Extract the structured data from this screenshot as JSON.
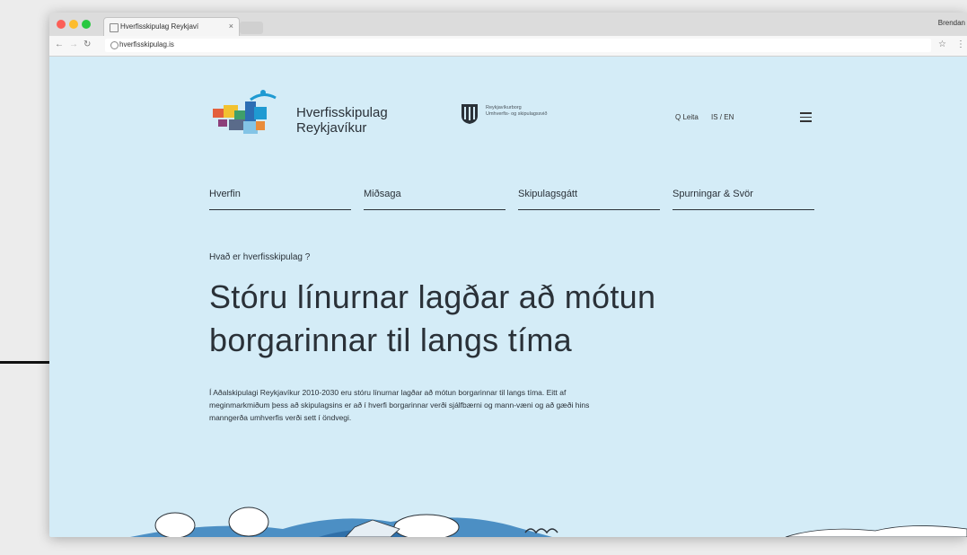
{
  "browser": {
    "tab_title": "Hverfisskipulag Reykjaví",
    "tab_close": "×",
    "user_label": "Brendan",
    "url": "hverfisskipulag.is"
  },
  "site": {
    "logo_line1": "Hverfisskipulag",
    "logo_line2": "Reykjavíkur",
    "partner_line1": "Reykjavíkurborg",
    "partner_line2": "Umhverfis- og skipulagssvið",
    "search_label": "Q Leita",
    "lang_label": "IS / EN"
  },
  "nav": {
    "items": [
      {
        "label": "Hverfin"
      },
      {
        "label": "Miðsaga"
      },
      {
        "label": "Skipulagsgátt"
      },
      {
        "label": "Spurningar & Svör"
      }
    ]
  },
  "hero": {
    "eyebrow": "Hvað er hverfisskipulag ?",
    "headline_line1": "Stóru línurnar lagðar að mótun",
    "headline_line2": "borgarinnar til langs tíma",
    "body": "Í Aðalskipulagi Reykjavíkur 2010-2030 eru stóru línurnar lagðar að mótun borgarinnar til langs tíma. Eitt af meginmarkmiðum þess að skipulagsins er að í hverfi borgarinnar verði sjálfbærni og mann-væni og að gæði hins manngerða umhverfis verði sett í öndvegi."
  },
  "colors": {
    "page_bg": "#d4ecf7",
    "text": "#2a3138"
  }
}
